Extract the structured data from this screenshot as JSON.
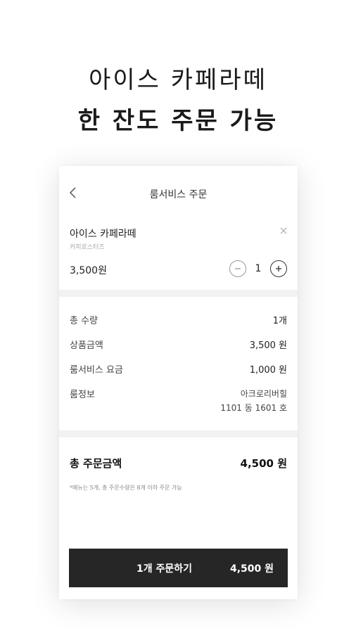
{
  "promo": {
    "line1": "아이스 카페라떼",
    "line2": "한 잔도 주문 가능"
  },
  "header": {
    "title": "룸서비스 주문",
    "back_icon": "chevron-left-icon"
  },
  "item": {
    "name": "아이스 카페라떼",
    "store": "커피로스터즈",
    "price": "3,500원",
    "quantity": "1",
    "remove_icon": "close-icon"
  },
  "summary": {
    "qty_label": "총 수량",
    "qty_value": "1개",
    "product_label": "상품금액",
    "product_value": "3,500 원",
    "fee_label": "룸서비스 요금",
    "fee_value": "1,000 원",
    "room_label": "룸정보",
    "room_building": "아크로리버힐",
    "room_unit": "1101 동   1601 호"
  },
  "total": {
    "label": "총 주문금액",
    "value": "4,500 원",
    "note": "*메뉴는 5개, 총 주문수량은 8개 이하 주문 가능"
  },
  "order_button": {
    "label": "1개  주문하기",
    "amount": "4,500 원"
  }
}
